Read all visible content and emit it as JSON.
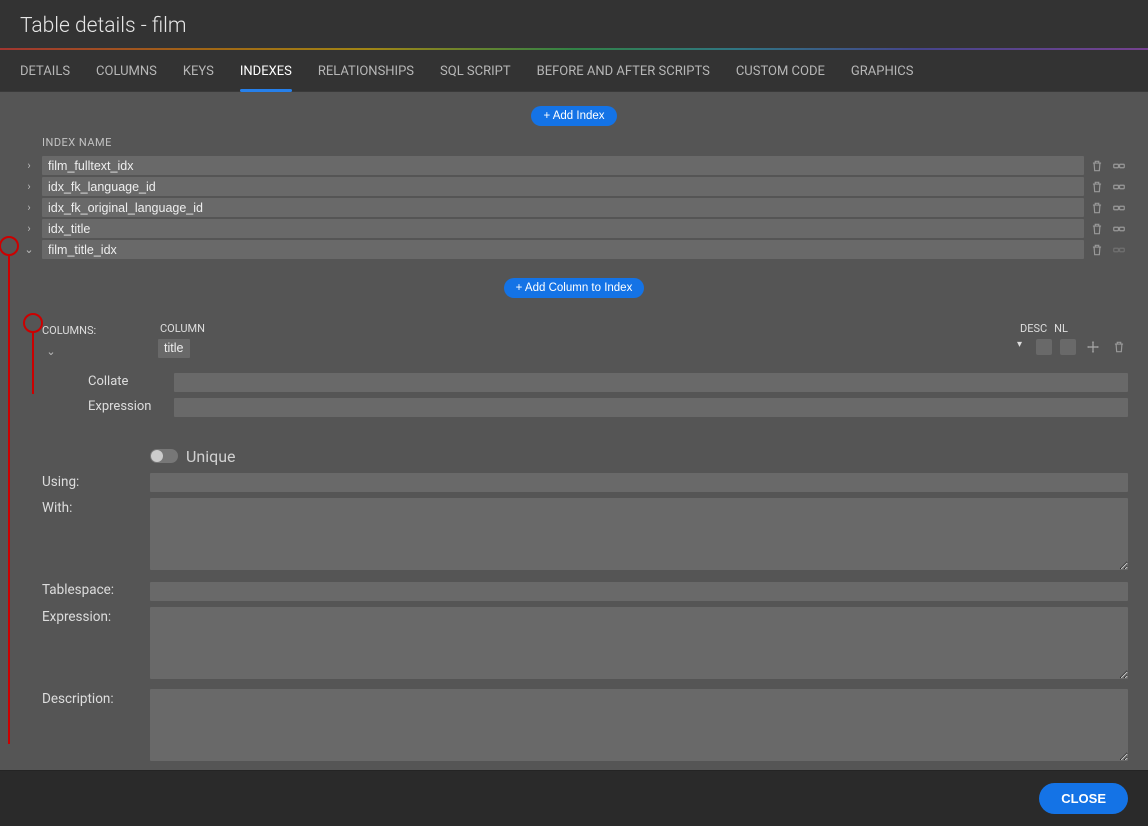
{
  "title": "Table details - film",
  "tabs": {
    "details": "DETAILS",
    "columns": "COLUMNS",
    "keys": "KEYS",
    "indexes": "INDEXES",
    "relationships": "RELATIONSHIPS",
    "sql_script": "SQL SCRIPT",
    "before_after": "BEFORE AND AFTER SCRIPTS",
    "custom_code": "CUSTOM CODE",
    "graphics": "GRAPHICS"
  },
  "buttons": {
    "add_index": "+ Add Index",
    "add_column": "+ Add Column to Index",
    "close": "CLOSE"
  },
  "headers": {
    "index_name": "INDEX NAME",
    "columns": "COLUMNS:",
    "column": "COLUMN",
    "desc": "DESC",
    "nl": "NL"
  },
  "indexes": [
    {
      "name": "film_fulltext_idx",
      "expanded": false
    },
    {
      "name": "idx_fk_language_id",
      "expanded": false
    },
    {
      "name": "idx_fk_original_language_id",
      "expanded": false
    },
    {
      "name": "idx_title",
      "expanded": false
    },
    {
      "name": "film_title_idx",
      "expanded": true
    }
  ],
  "index_columns": [
    {
      "column": "title",
      "desc": false,
      "nl": false
    }
  ],
  "detail": {
    "collate_label": "Collate",
    "collate": "",
    "expression_label": "Expression",
    "expression": ""
  },
  "form": {
    "unique_label": "Unique",
    "unique": false,
    "using_label": "Using:",
    "using": "",
    "with_label": "With:",
    "with": "",
    "tablespace_label": "Tablespace:",
    "tablespace": "",
    "expression_label": "Expression:",
    "expression": "",
    "description_label": "Description:",
    "description": ""
  }
}
